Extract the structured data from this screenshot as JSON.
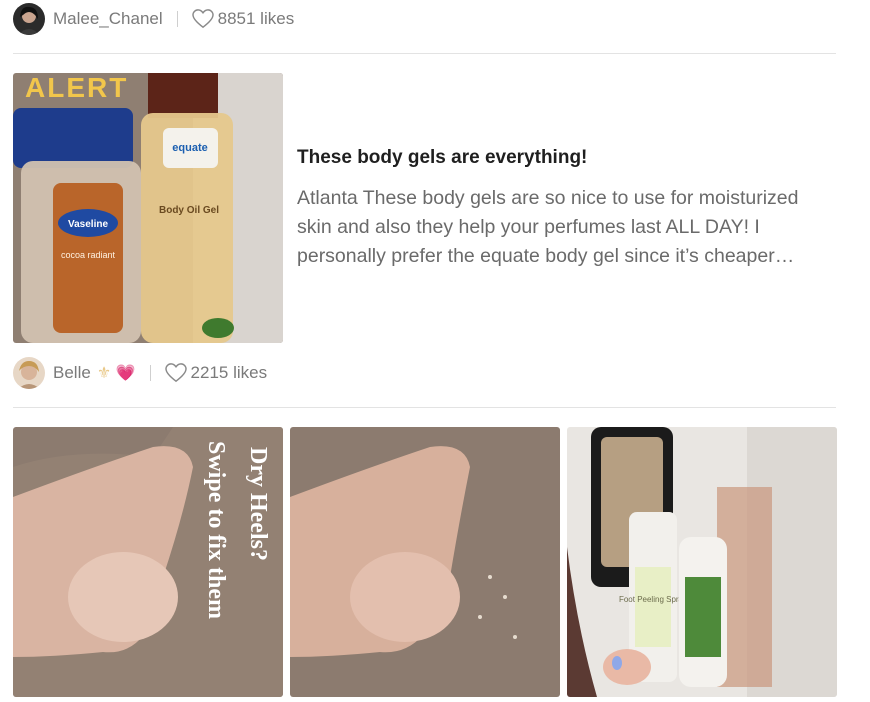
{
  "post1": {
    "author": "Malee_Chanel",
    "likes": "8851 likes"
  },
  "article": {
    "image_caption": "ALERT",
    "title": "These body gels are everything!",
    "excerpt": "Atlanta These body gels are so nice to use for moisturized skin and also they help your perfumes last ALL DAY! I personally prefer the equate body gel since it’s cheaper…",
    "product_labels": {
      "left_brand": "Vaseline",
      "left_sub": "cocoa radiant",
      "right_brand": "equate",
      "right_sub": "Body Oil Gel"
    }
  },
  "post2": {
    "author": "Belle",
    "author_emojis": "⚜ 💗",
    "likes": "2215 likes"
  },
  "gallery": {
    "overlay_line1": "Dry Heels?",
    "overlay_line2": "Swipe to fix them",
    "spray_label": "Foot Peeling Spray"
  },
  "colors": {
    "accent_title": "#1f1f1f",
    "muted_text": "#7a7a7a",
    "divider": "#e3e3e3",
    "heart_stroke": "#8a8a8a"
  },
  "icons": {
    "heart": "heart-icon"
  }
}
